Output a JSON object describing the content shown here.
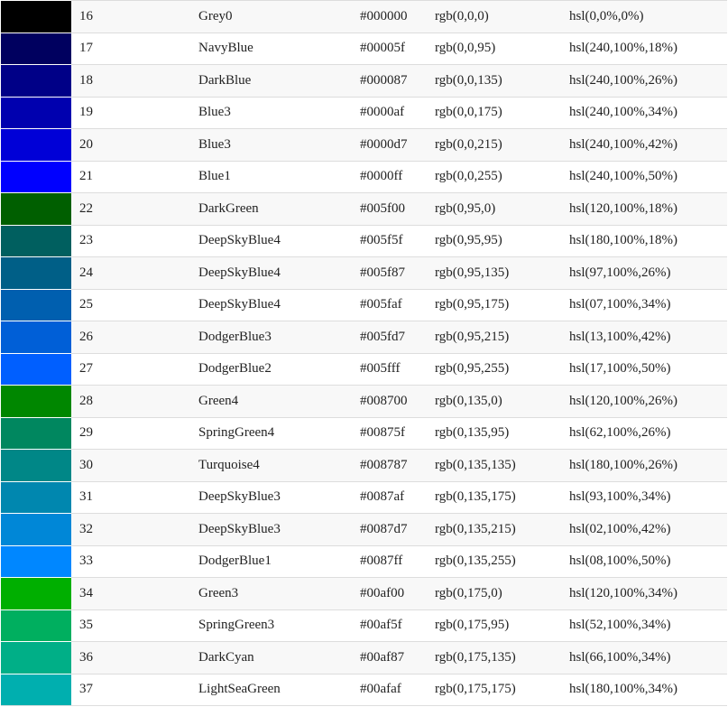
{
  "colors": [
    {
      "num": "16",
      "name": "Grey0",
      "hex": "#000000",
      "rgb": "rgb(0,0,0)",
      "hsl": "hsl(0,0%,0%)",
      "swatch": "#000000"
    },
    {
      "num": "17",
      "name": "NavyBlue",
      "hex": "#00005f",
      "rgb": "rgb(0,0,95)",
      "hsl": "hsl(240,100%,18%)",
      "swatch": "#00005f"
    },
    {
      "num": "18",
      "name": "DarkBlue",
      "hex": "#000087",
      "rgb": "rgb(0,0,135)",
      "hsl": "hsl(240,100%,26%)",
      "swatch": "#000087"
    },
    {
      "num": "19",
      "name": "Blue3",
      "hex": "#0000af",
      "rgb": "rgb(0,0,175)",
      "hsl": "hsl(240,100%,34%)",
      "swatch": "#0000af"
    },
    {
      "num": "20",
      "name": "Blue3",
      "hex": "#0000d7",
      "rgb": "rgb(0,0,215)",
      "hsl": "hsl(240,100%,42%)",
      "swatch": "#0000d7"
    },
    {
      "num": "21",
      "name": "Blue1",
      "hex": "#0000ff",
      "rgb": "rgb(0,0,255)",
      "hsl": "hsl(240,100%,50%)",
      "swatch": "#0000ff"
    },
    {
      "num": "22",
      "name": "DarkGreen",
      "hex": "#005f00",
      "rgb": "rgb(0,95,0)",
      "hsl": "hsl(120,100%,18%)",
      "swatch": "#005f00"
    },
    {
      "num": "23",
      "name": "DeepSkyBlue4",
      "hex": "#005f5f",
      "rgb": "rgb(0,95,95)",
      "hsl": "hsl(180,100%,18%)",
      "swatch": "#005f5f"
    },
    {
      "num": "24",
      "name": "DeepSkyBlue4",
      "hex": "#005f87",
      "rgb": "rgb(0,95,135)",
      "hsl": "hsl(97,100%,26%)",
      "swatch": "#005f87"
    },
    {
      "num": "25",
      "name": "DeepSkyBlue4",
      "hex": "#005faf",
      "rgb": "rgb(0,95,175)",
      "hsl": "hsl(07,100%,34%)",
      "swatch": "#005faf"
    },
    {
      "num": "26",
      "name": "DodgerBlue3",
      "hex": "#005fd7",
      "rgb": "rgb(0,95,215)",
      "hsl": "hsl(13,100%,42%)",
      "swatch": "#005fd7"
    },
    {
      "num": "27",
      "name": "DodgerBlue2",
      "hex": "#005fff",
      "rgb": "rgb(0,95,255)",
      "hsl": "hsl(17,100%,50%)",
      "swatch": "#005fff"
    },
    {
      "num": "28",
      "name": "Green4",
      "hex": "#008700",
      "rgb": "rgb(0,135,0)",
      "hsl": "hsl(120,100%,26%)",
      "swatch": "#008700"
    },
    {
      "num": "29",
      "name": "SpringGreen4",
      "hex": "#00875f",
      "rgb": "rgb(0,135,95)",
      "hsl": "hsl(62,100%,26%)",
      "swatch": "#00875f"
    },
    {
      "num": "30",
      "name": "Turquoise4",
      "hex": "#008787",
      "rgb": "rgb(0,135,135)",
      "hsl": "hsl(180,100%,26%)",
      "swatch": "#008787"
    },
    {
      "num": "31",
      "name": "DeepSkyBlue3",
      "hex": "#0087af",
      "rgb": "rgb(0,135,175)",
      "hsl": "hsl(93,100%,34%)",
      "swatch": "#0087af"
    },
    {
      "num": "32",
      "name": "DeepSkyBlue3",
      "hex": "#0087d7",
      "rgb": "rgb(0,135,215)",
      "hsl": "hsl(02,100%,42%)",
      "swatch": "#0087d7"
    },
    {
      "num": "33",
      "name": "DodgerBlue1",
      "hex": "#0087ff",
      "rgb": "rgb(0,135,255)",
      "hsl": "hsl(08,100%,50%)",
      "swatch": "#0087ff"
    },
    {
      "num": "34",
      "name": "Green3",
      "hex": "#00af00",
      "rgb": "rgb(0,175,0)",
      "hsl": "hsl(120,100%,34%)",
      "swatch": "#00af00"
    },
    {
      "num": "35",
      "name": "SpringGreen3",
      "hex": "#00af5f",
      "rgb": "rgb(0,175,95)",
      "hsl": "hsl(52,100%,34%)",
      "swatch": "#00af5f"
    },
    {
      "num": "36",
      "name": "DarkCyan",
      "hex": "#00af87",
      "rgb": "rgb(0,175,135)",
      "hsl": "hsl(66,100%,34%)",
      "swatch": "#00af87"
    },
    {
      "num": "37",
      "name": "LightSeaGreen",
      "hex": "#00afaf",
      "rgb": "rgb(0,175,175)",
      "hsl": "hsl(180,100%,34%)",
      "swatch": "#00afaf"
    }
  ]
}
